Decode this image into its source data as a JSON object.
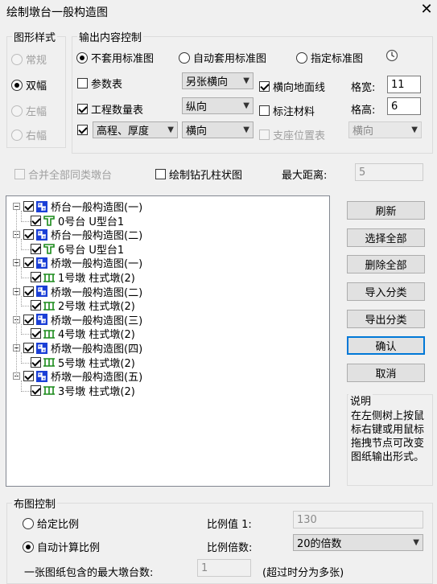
{
  "window": {
    "title": "绘制墩台一般构造图",
    "close": "✕"
  },
  "style_group": {
    "legend": "图形样式",
    "options": [
      {
        "label": "常规",
        "selected": false,
        "enabled": false
      },
      {
        "label": "双幅",
        "selected": true,
        "enabled": true
      },
      {
        "label": "左幅",
        "selected": false,
        "enabled": false
      },
      {
        "label": "右幅",
        "selected": false,
        "enabled": false
      }
    ]
  },
  "output_group": {
    "legend": "输出内容控制",
    "mode_radios": [
      {
        "label": "不套用标准图",
        "selected": true
      },
      {
        "label": "自动套用标准图",
        "selected": false
      },
      {
        "label": "指定标准图",
        "selected": false
      }
    ],
    "rows": [
      {
        "check": {
          "label": "参数表",
          "checked": false
        },
        "combo": "另张横向"
      },
      {
        "check": {
          "label": "工程数量表",
          "checked": true
        },
        "combo": "纵向"
      },
      {
        "check": {
          "label": "",
          "checked": true
        },
        "combo_first": "高程、厚度",
        "combo": "横向"
      }
    ],
    "right_checks": [
      {
        "label": "横向地面线",
        "checked": true,
        "enabled": true
      },
      {
        "label": "标注材料",
        "checked": false,
        "enabled": true
      },
      {
        "label": "支座位置表",
        "checked": false,
        "enabled": false
      }
    ],
    "grid_width_label": "格宽:",
    "grid_width_value": "11",
    "grid_height_label": "格高:",
    "grid_height_value": "6",
    "support_combo": "横向"
  },
  "merge_check": {
    "label": "合并全部同类墩台",
    "checked": false,
    "enabled": false
  },
  "bore_check": {
    "label": "绘制钻孔柱状图",
    "checked": false
  },
  "max_distance": {
    "label": "最大距离:",
    "value": "5"
  },
  "tree": [
    {
      "label": "桥台一般构造图(一)",
      "child": "0号台 U型台1",
      "child_type": "abutment"
    },
    {
      "label": "桥台一般构造图(二)",
      "child": "6号台 U型台1",
      "child_type": "abutment"
    },
    {
      "label": "桥墩一般构造图(一)",
      "child": "1号墩 柱式墩(2)",
      "child_type": "pier"
    },
    {
      "label": "桥墩一般构造图(二)",
      "child": "2号墩 柱式墩(2)",
      "child_type": "pier"
    },
    {
      "label": "桥墩一般构造图(三)",
      "child": "4号墩 柱式墩(2)",
      "child_type": "pier"
    },
    {
      "label": "桥墩一般构造图(四)",
      "child": "5号墩 柱式墩(2)",
      "child_type": "pier"
    },
    {
      "label": "桥墩一般构造图(五)",
      "child": "3号墩 柱式墩(2)",
      "child_type": "pier"
    }
  ],
  "buttons": {
    "refresh": "刷新",
    "select_all": "选择全部",
    "delete_all": "删除全部",
    "import_class": "导入分类",
    "export_class": "导出分类",
    "ok": "确认",
    "cancel": "取消"
  },
  "info": {
    "caption": "说明",
    "text": "在左侧树上按鼠标右键或用鼠标拖拽节点可改变图纸输出形式。"
  },
  "layout_group": {
    "legend": "布图控制",
    "given_scale": {
      "label": "给定比例",
      "selected": false
    },
    "auto_scale": {
      "label": "自动计算比例",
      "selected": true
    },
    "scale_value_label": "比例值 1:",
    "scale_value": "130",
    "scale_multiple_label": "比例倍数:",
    "scale_multiple": "20的倍数",
    "max_piers_label": "一张图纸包含的最大墩台数:",
    "max_piers_value": "1",
    "max_piers_note": "(超过时分为多张)"
  },
  "colors": {
    "accent": "#0078d7",
    "tree_icon_blue": "#1a3fd6",
    "tree_icon_green": "#1a8a1a"
  }
}
